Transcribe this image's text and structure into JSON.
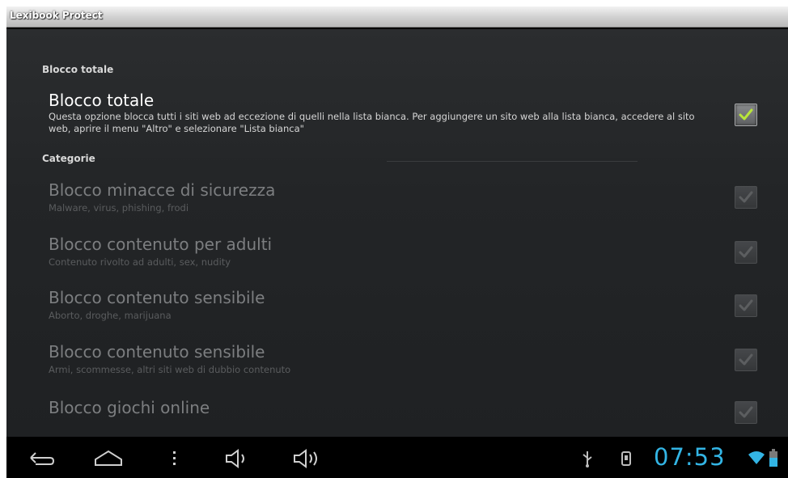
{
  "app": {
    "title": "Lexibook Protect"
  },
  "sections": [
    {
      "header": "Blocco totale"
    },
    {
      "header": "Categorie"
    }
  ],
  "preferences": [
    {
      "title": "Blocco totale",
      "summary": "Questa opzione blocca tutti i siti web ad eccezione di quelli nella lista bianca. Per aggiungere un sito web alla lista bianca, accedere al sito web, aprire il menu \"Altro\" e selezionare \"Lista bianca\"",
      "checked": true,
      "enabled": true
    },
    {
      "title": "Blocco minacce di sicurezza",
      "summary": "Malware, virus, phishing, frodi",
      "checked": true,
      "enabled": false
    },
    {
      "title": "Blocco contenuto per adulti",
      "summary": "Contenuto rivolto ad adulti, sex, nudity",
      "checked": true,
      "enabled": false
    },
    {
      "title": "Blocco contenuto sensibile",
      "summary": "Aborto, droghe, marijuana",
      "checked": true,
      "enabled": false
    },
    {
      "title": "Blocco contenuto sensibile",
      "summary": "Armi, scommesse, altri siti web di dubbio contenuto",
      "checked": true,
      "enabled": false
    },
    {
      "title": "Blocco giochi online",
      "summary": "",
      "checked": true,
      "enabled": false
    }
  ],
  "status_bar": {
    "clock": "07:53",
    "accent_color": "#33b5e5",
    "icons": [
      "usb-icon",
      "notification-icon",
      "wifi-icon",
      "battery-icon"
    ]
  },
  "nav_buttons": [
    "back-icon",
    "home-icon",
    "menu-icon",
    "volume-down-icon",
    "volume-up-icon"
  ]
}
